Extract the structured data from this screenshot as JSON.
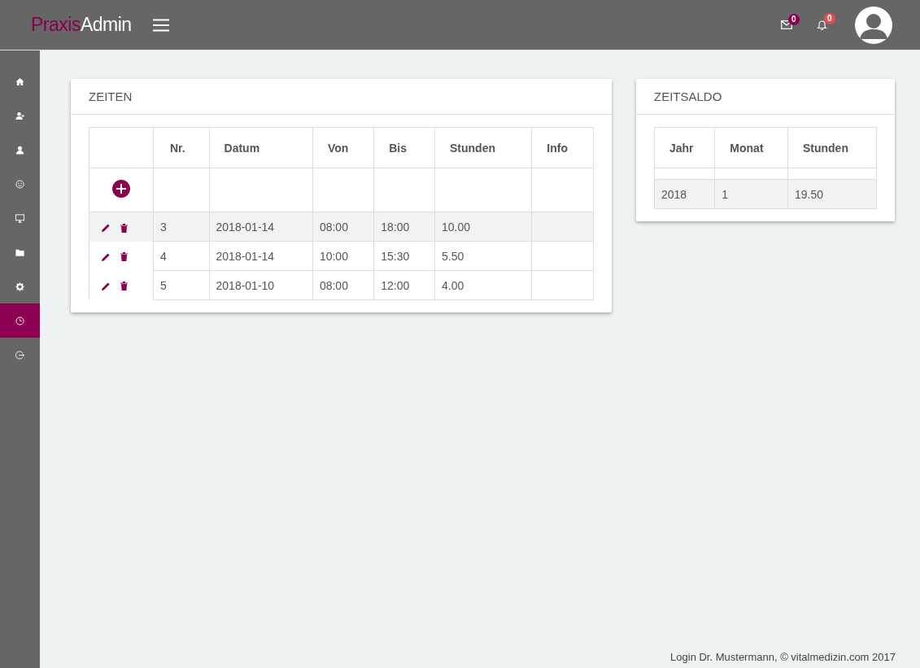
{
  "header": {
    "logo_part_1": "Praxis",
    "logo_part_2": "Admin",
    "mail_count": "0",
    "notification_count": "0"
  },
  "sidebar": {
    "items": [
      {
        "kind": "home",
        "selected": false
      },
      {
        "kind": "user-add",
        "selected": false
      },
      {
        "kind": "user",
        "selected": false
      },
      {
        "kind": "smiley",
        "selected": false
      },
      {
        "kind": "monitor",
        "selected": false
      },
      {
        "kind": "folder",
        "selected": false
      },
      {
        "kind": "gear",
        "selected": false
      },
      {
        "kind": "clock",
        "selected": true
      },
      {
        "kind": "logout",
        "selected": false
      }
    ]
  },
  "zeiten": {
    "title": "ZEITEN",
    "columns": [
      "Nr.",
      "Datum",
      "Von",
      "Bis",
      "Stunden",
      "Info"
    ],
    "rows": [
      {
        "highlighted": true,
        "cells": [
          "3",
          "2018-01-14",
          "08:00",
          "18:00",
          "10.00",
          ""
        ]
      },
      {
        "highlighted": false,
        "cells": [
          "4",
          "2018-01-14",
          "10:00",
          "15:30",
          "5.50",
          ""
        ]
      },
      {
        "highlighted": false,
        "cells": [
          "5",
          "2018-01-10",
          "08:00",
          "12:00",
          "4.00",
          ""
        ]
      }
    ]
  },
  "zeitsaldo": {
    "title": "ZEITSALDO",
    "columns": [
      "Jahr",
      "Monat",
      "Stunden"
    ],
    "rows": [
      {
        "highlighted": true,
        "cells": [
          "2018",
          "1",
          "19.50"
        ]
      }
    ]
  },
  "footer": "Login Dr. Mustermann, © vitalmedizin.com 2017"
}
